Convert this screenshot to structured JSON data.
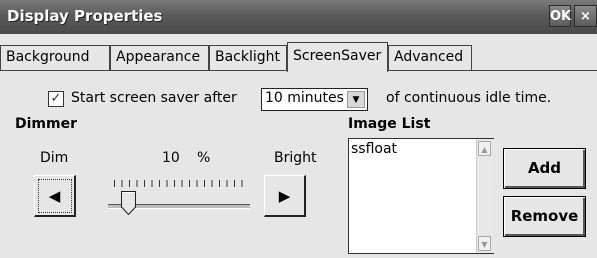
{
  "window": {
    "title": "Display Properties",
    "ok_label": "OK",
    "close_label": "×"
  },
  "tabs": [
    {
      "label": "Background",
      "active": false
    },
    {
      "label": "Appearance",
      "active": false
    },
    {
      "label": "Backlight",
      "active": false
    },
    {
      "label": "ScreenSaver",
      "active": true
    },
    {
      "label": "Advanced",
      "active": false
    }
  ],
  "screensaver": {
    "start_label": "Start screen saver after",
    "start_checked": true,
    "check_glyph": "✓",
    "idle_value": "10 minutes",
    "select_arrow": "▼",
    "suffix_label": "of continuous idle time."
  },
  "dimmer": {
    "heading": "Dimmer",
    "dim_label": "Dim",
    "value": "10",
    "unit": "%",
    "bright_label": "Bright",
    "left_arrow": "◀",
    "right_arrow": "▶",
    "slider_fraction": 0.1
  },
  "image_list": {
    "heading": "Image List",
    "items": [
      "ssfloat"
    ],
    "scroll_up": "▲",
    "scroll_down": "▼",
    "add_label": "Add",
    "remove_label": "Remove"
  }
}
